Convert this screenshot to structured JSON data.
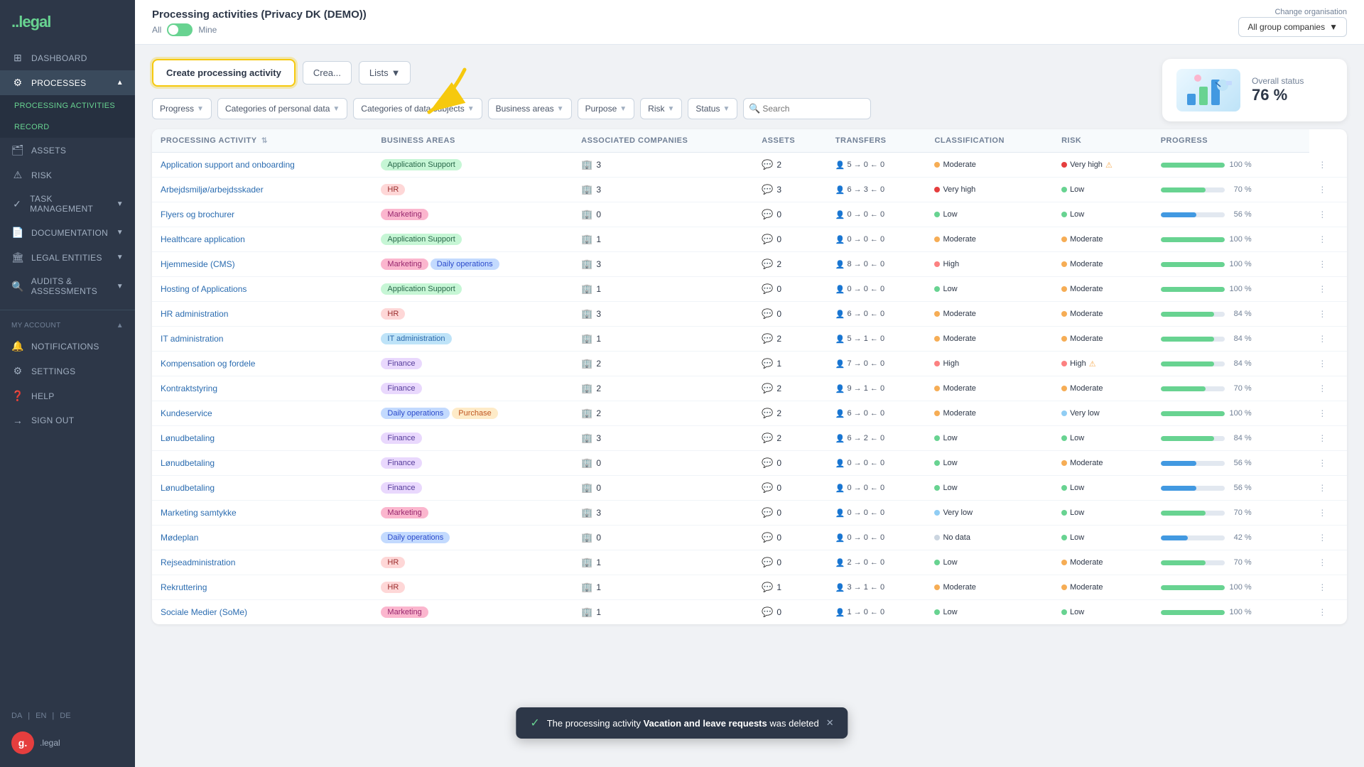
{
  "sidebar": {
    "logo": ".legal",
    "items": [
      {
        "id": "dashboard",
        "label": "Dashboard",
        "icon": "⊞",
        "active": false
      },
      {
        "id": "processes",
        "label": "Processes",
        "icon": "⚙",
        "active": true,
        "expandable": true
      },
      {
        "id": "processing-activities",
        "label": "Processing Activities",
        "icon": "",
        "active": true,
        "sub": true
      },
      {
        "id": "record",
        "label": "Record",
        "icon": "",
        "active": false,
        "sub": true
      },
      {
        "id": "assets",
        "label": "Assets",
        "icon": "🗂",
        "active": false
      },
      {
        "id": "risk",
        "label": "Risk",
        "icon": "⚠",
        "active": false
      },
      {
        "id": "task-management",
        "label": "Task Management",
        "icon": "✓",
        "active": false,
        "expandable": true
      },
      {
        "id": "documentation",
        "label": "Documentation",
        "icon": "📄",
        "active": false,
        "expandable": true
      },
      {
        "id": "legal-entities",
        "label": "Legal Entities",
        "icon": "🏛",
        "active": false,
        "expandable": true
      },
      {
        "id": "audits-assessments",
        "label": "Audits & Assessments",
        "icon": "🔍",
        "active": false,
        "expandable": true
      }
    ],
    "my_account": "My Account",
    "account_items": [
      {
        "id": "notifications",
        "label": "Notifications",
        "icon": "🔔"
      },
      {
        "id": "settings",
        "label": "Settings",
        "icon": "⚙"
      },
      {
        "id": "help",
        "label": "Help",
        "icon": "?"
      },
      {
        "id": "sign-out",
        "label": "Sign Out",
        "icon": "→"
      }
    ],
    "languages": [
      "DA",
      "EN",
      "DE"
    ],
    "avatar": "g."
  },
  "topbar": {
    "title": "Processing activities (Privacy DK (DEMO))",
    "toggle_all": "All",
    "toggle_mine": "Mine",
    "change_org_label": "Change organisation",
    "org_dropdown": "All group companies"
  },
  "toolbar": {
    "create_label": "Create processing activity",
    "create2_label": "Crea...",
    "lists_label": "Lists"
  },
  "overall_status": {
    "label": "Overall status",
    "value": "76 %"
  },
  "filters": {
    "progress": "Progress",
    "categories_personal_data": "Categories of personal data",
    "categories_data_subjects": "Categories of data subjects",
    "business_areas": "Business areas",
    "purpose": "Purpose",
    "risk": "Risk",
    "status": "Status",
    "search_placeholder": "Search"
  },
  "table": {
    "columns": [
      {
        "id": "activity",
        "label": "Processing Activity",
        "sortable": true
      },
      {
        "id": "business_areas",
        "label": "Business Areas"
      },
      {
        "id": "associated_companies",
        "label": "Associated Companies"
      },
      {
        "id": "assets",
        "label": "Assets"
      },
      {
        "id": "transfers",
        "label": "Transfers"
      },
      {
        "id": "classification",
        "label": "Classification"
      },
      {
        "id": "risk",
        "label": "Risk"
      },
      {
        "id": "progress",
        "label": "Progress"
      }
    ],
    "rows": [
      {
        "name": "Application support and onboarding",
        "tags": [
          {
            "label": "Application Support",
            "type": "app-support"
          }
        ],
        "companies": 3,
        "assets": 2,
        "transfers": "5 → 0 ← 0",
        "classification": "Moderate",
        "classification_level": "moderate",
        "risk": "Very high",
        "risk_level": "very-high",
        "risk_warn": true,
        "progress": 100,
        "progress_color": "green"
      },
      {
        "name": "Arbejdsmiljø/arbejdsskader",
        "tags": [
          {
            "label": "HR",
            "type": "hr"
          }
        ],
        "companies": 3,
        "assets": 3,
        "transfers": "6 → 3 ← 0",
        "classification": "Very high",
        "classification_level": "very-high",
        "risk": "Low",
        "risk_level": "low",
        "progress": 70,
        "progress_color": "green"
      },
      {
        "name": "Flyers og brochurer",
        "tags": [
          {
            "label": "Marketing",
            "type": "marketing"
          }
        ],
        "companies": 0,
        "assets": 0,
        "transfers": "0 → 0 ← 0",
        "classification": "Low",
        "classification_level": "low",
        "risk": "Low",
        "risk_level": "low",
        "progress": 56,
        "progress_color": "blue"
      },
      {
        "name": "Healthcare application",
        "tags": [
          {
            "label": "Application Support",
            "type": "app-support"
          }
        ],
        "companies": 1,
        "assets": 0,
        "transfers": "0 → 0 ← 0",
        "classification": "Moderate",
        "classification_level": "moderate",
        "risk": "Moderate",
        "risk_level": "moderate",
        "progress": 100,
        "progress_color": "green"
      },
      {
        "name": "Hjemmeside (CMS)",
        "tags": [
          {
            "label": "Marketing",
            "type": "marketing"
          },
          {
            "label": "Daily operations",
            "type": "daily-ops"
          }
        ],
        "companies": 3,
        "assets": 2,
        "transfers": "8 → 0 ← 0",
        "classification": "High",
        "classification_level": "high",
        "risk": "Moderate",
        "risk_level": "moderate",
        "progress": 100,
        "progress_color": "green"
      },
      {
        "name": "Hosting of Applications",
        "tags": [
          {
            "label": "Application Support",
            "type": "app-support"
          }
        ],
        "companies": 1,
        "assets": 0,
        "transfers": "0 → 0 ← 0",
        "classification": "Low",
        "classification_level": "low",
        "risk": "Moderate",
        "risk_level": "moderate",
        "progress": 100,
        "progress_color": "green"
      },
      {
        "name": "HR administration",
        "tags": [
          {
            "label": "HR",
            "type": "hr"
          }
        ],
        "companies": 3,
        "assets": 0,
        "transfers": "6 → 0 ← 0",
        "classification": "Moderate",
        "classification_level": "moderate",
        "risk": "Moderate",
        "risk_level": "moderate",
        "progress": 84,
        "progress_color": "green"
      },
      {
        "name": "IT administration",
        "tags": [
          {
            "label": "IT administration",
            "type": "it-admin"
          }
        ],
        "companies": 1,
        "assets": 2,
        "transfers": "5 → 1 ← 0",
        "classification": "Moderate",
        "classification_level": "moderate",
        "risk": "Moderate",
        "risk_level": "moderate",
        "progress": 84,
        "progress_color": "green"
      },
      {
        "name": "Kompensation og fordele",
        "tags": [
          {
            "label": "Finance",
            "type": "finance"
          }
        ],
        "companies": 2,
        "assets": 1,
        "transfers": "7 → 0 ← 0",
        "classification": "High",
        "classification_level": "high",
        "risk": "High",
        "risk_level": "high",
        "risk_warn": true,
        "progress": 84,
        "progress_color": "green"
      },
      {
        "name": "Kontraktstyring",
        "tags": [
          {
            "label": "Finance",
            "type": "finance"
          }
        ],
        "companies": 2,
        "assets": 2,
        "transfers": "9 → 1 ← 0",
        "classification": "Moderate",
        "classification_level": "moderate",
        "risk": "Moderate",
        "risk_level": "moderate",
        "progress": 70,
        "progress_color": "green"
      },
      {
        "name": "Kundeservice",
        "tags": [
          {
            "label": "Daily operations",
            "type": "daily-ops"
          },
          {
            "label": "Purchase",
            "type": "purchase"
          }
        ],
        "companies": 2,
        "assets": 2,
        "transfers": "6 → 0 ← 0",
        "classification": "Moderate",
        "classification_level": "moderate",
        "risk": "Very low",
        "risk_level": "very-low",
        "progress": 100,
        "progress_color": "green"
      },
      {
        "name": "Lønudbetaling",
        "tags": [
          {
            "label": "Finance",
            "type": "finance"
          }
        ],
        "companies": 3,
        "assets": 2,
        "transfers": "6 → 2 ← 0",
        "classification": "Low",
        "classification_level": "low",
        "risk": "Low",
        "risk_level": "low",
        "progress": 84,
        "progress_color": "green"
      },
      {
        "name": "Lønudbetaling",
        "tags": [
          {
            "label": "Finance",
            "type": "finance"
          }
        ],
        "companies": 0,
        "assets": 0,
        "transfers": "0 → 0 ← 0",
        "classification": "Low",
        "classification_level": "low",
        "risk": "Moderate",
        "risk_level": "moderate",
        "progress": 56,
        "progress_color": "blue"
      },
      {
        "name": "Lønudbetaling",
        "tags": [
          {
            "label": "Finance",
            "type": "finance"
          }
        ],
        "companies": 0,
        "assets": 0,
        "transfers": "0 → 0 ← 0",
        "classification": "Low",
        "classification_level": "low",
        "risk": "Low",
        "risk_level": "low",
        "progress": 56,
        "progress_color": "blue"
      },
      {
        "name": "Marketing samtykke",
        "tags": [
          {
            "label": "Marketing",
            "type": "marketing"
          }
        ],
        "companies": 3,
        "assets": 0,
        "transfers": "0 → 0 ← 0",
        "classification": "Very low",
        "classification_level": "very-low",
        "risk": "Low",
        "risk_level": "low",
        "progress": 70,
        "progress_color": "green"
      },
      {
        "name": "Mødeplan",
        "tags": [
          {
            "label": "Daily operations",
            "type": "daily-ops"
          }
        ],
        "companies": 0,
        "assets": 0,
        "transfers": "0 → 0 ← 0",
        "classification": "No data",
        "classification_level": "no-data",
        "risk": "Low",
        "risk_level": "low",
        "progress": 42,
        "progress_color": "blue"
      },
      {
        "name": "Rejseadministration",
        "tags": [
          {
            "label": "HR",
            "type": "hr"
          }
        ],
        "companies": 1,
        "assets": 0,
        "transfers": "2 → 0 ← 0",
        "classification": "Low",
        "classification_level": "low",
        "risk": "Moderate",
        "risk_level": "moderate",
        "progress": 70,
        "progress_color": "green"
      },
      {
        "name": "Rekruttering",
        "tags": [
          {
            "label": "HR",
            "type": "hr"
          }
        ],
        "companies": 1,
        "assets": 1,
        "transfers": "3 → 1 ← 0",
        "classification": "Moderate",
        "classification_level": "moderate",
        "risk": "Moderate",
        "risk_level": "moderate",
        "progress": 100,
        "progress_color": "green"
      },
      {
        "name": "Sociale Medier (SoMe)",
        "tags": [
          {
            "label": "Marketing",
            "type": "marketing"
          }
        ],
        "companies": 1,
        "assets": 0,
        "transfers": "1 → 0 ← 0",
        "classification": "Low",
        "classification_level": "low",
        "risk": "Low",
        "risk_level": "low",
        "progress": 100,
        "progress_color": "green"
      }
    ]
  },
  "toast": {
    "message_prefix": "The processing activity",
    "highlight": "Vacation and leave requests",
    "message_suffix": "was deleted"
  },
  "colors": {
    "accent": "#f6c90e",
    "green": "#68d391",
    "blue": "#4299e1"
  }
}
